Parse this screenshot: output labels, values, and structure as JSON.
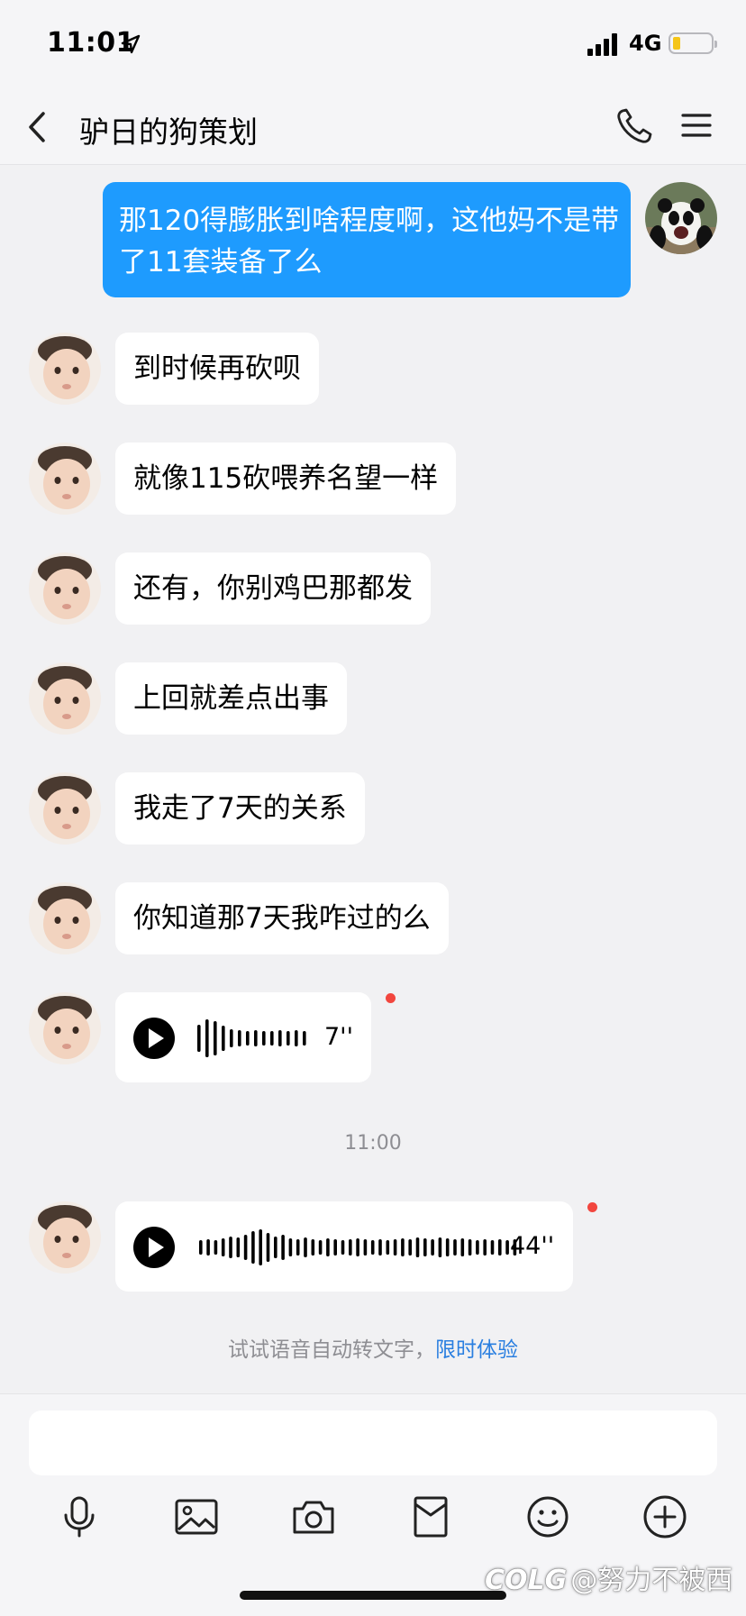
{
  "status_bar": {
    "time": "11:01",
    "network": "4G",
    "battery_level": 0.2
  },
  "nav": {
    "title": "驴日的狗策划"
  },
  "messages": [
    {
      "text": "那120得膨胀到啥程度啊，这他妈不是带了11套装备了么"
    },
    {
      "text": "到时候再砍呗"
    },
    {
      "text": "就像115砍喂养名望一样"
    },
    {
      "text": "还有，你别鸡巴那都发"
    },
    {
      "text": "上回就差点出事"
    },
    {
      "text": "我走了7天的关系"
    },
    {
      "text": "你知道那7天我咋过的么"
    },
    {
      "duration": "7''",
      "unread": true
    },
    {
      "duration": "44''",
      "unread": true
    }
  ],
  "timestamp": "11:00",
  "hint": {
    "text": "试试语音自动转文字，",
    "link": "限时体验"
  },
  "input": {
    "placeholder": ""
  },
  "toolbar": {
    "icons": [
      "microphone-icon",
      "image-icon",
      "camera-icon",
      "red-packet-icon",
      "emoji-icon",
      "plus-icon"
    ]
  },
  "watermark": {
    "logo": "COLG",
    "text": "@努力不被西"
  },
  "colors": {
    "outgoing_bubble": "#1e9bfe",
    "incoming_bubble": "#ffffff",
    "background": "#f1f1f3",
    "link": "#2a7fe0",
    "unread_dot": "#f2463e"
  }
}
